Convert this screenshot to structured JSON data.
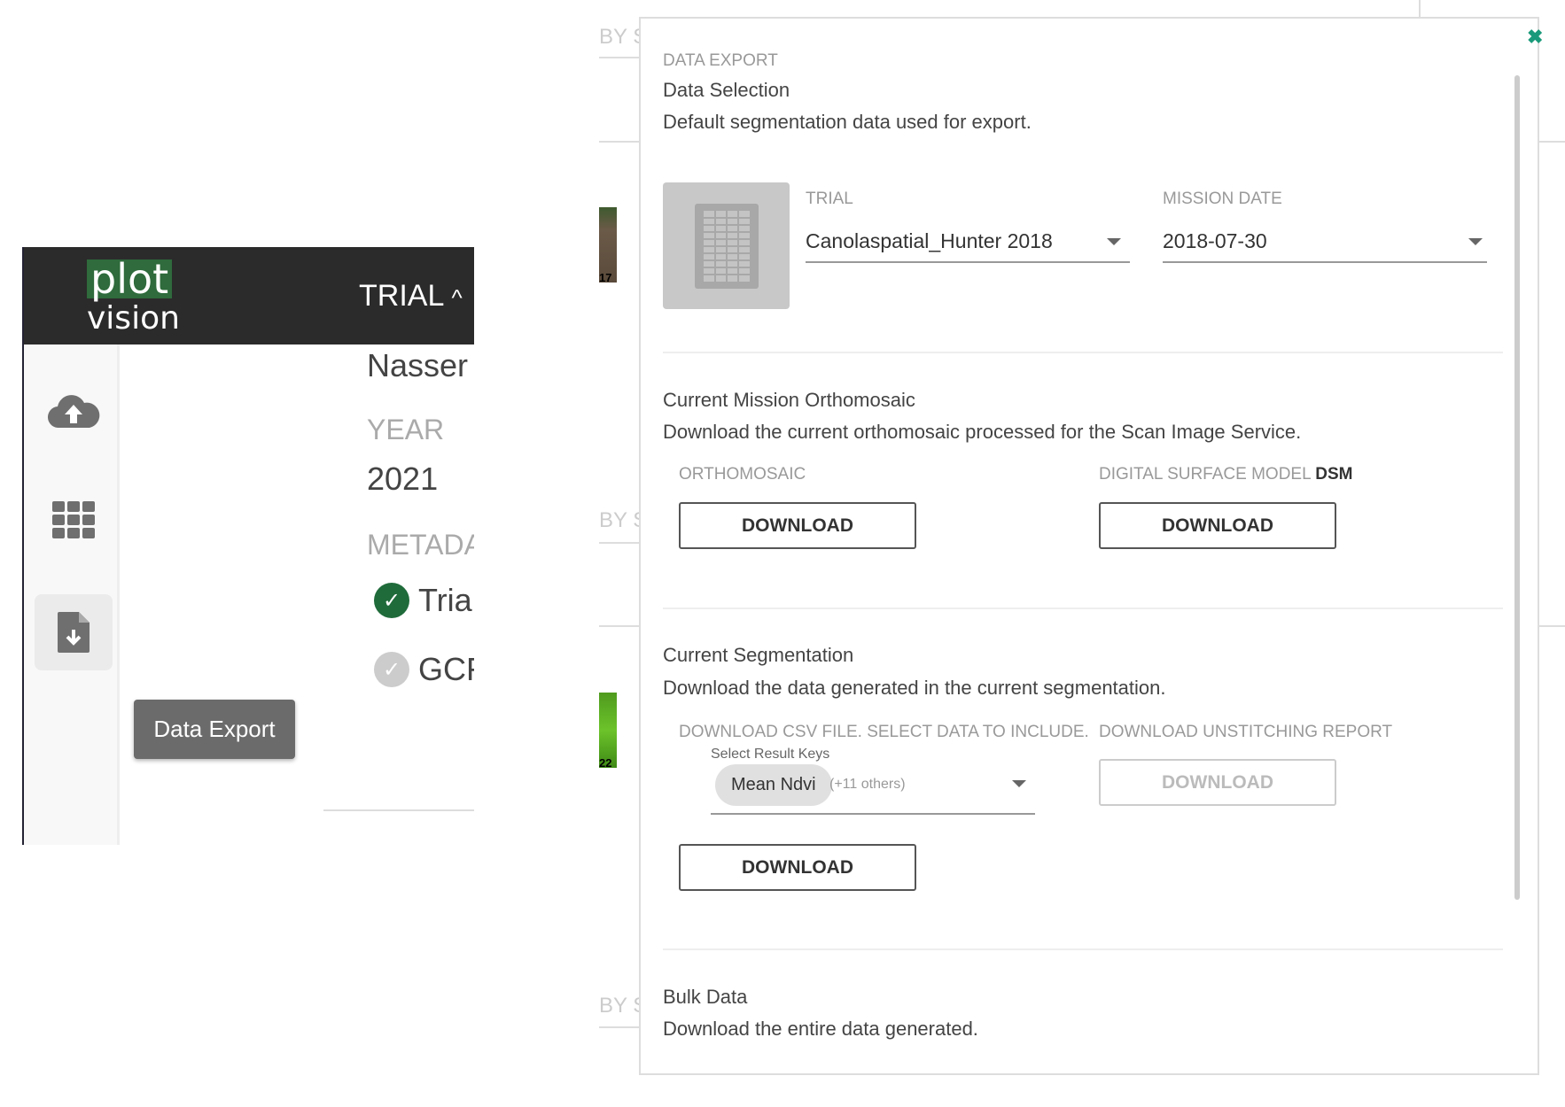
{
  "app": {
    "logo_top": "plot",
    "logo_bottom": "vision",
    "header_title": "TRIAL",
    "sidebar": [
      {
        "icon": "cloud-upload-icon"
      },
      {
        "icon": "grid-icon"
      },
      {
        "icon": "file-download-icon",
        "tooltip": "Data Export"
      }
    ],
    "panel": {
      "name": "Nasser",
      "year_label": "YEAR",
      "year": "2021",
      "metadata_label": "METADA",
      "metadata_items": [
        {
          "label": "Trial",
          "status": "complete",
          "color": "#1f6b3a"
        },
        {
          "label": "GCF",
          "status": "pending",
          "color": "#cccccc"
        }
      ]
    },
    "background_labels": [
      "BY ST",
      "BY ST",
      "BY ST"
    ],
    "background_thumb_labels": [
      "17",
      "22"
    ]
  },
  "dialog": {
    "caption": "DATA EXPORT",
    "close_icon": "close-icon",
    "accent": "#1a9a7a",
    "selection": {
      "title": "Data Selection",
      "description": "Default segmentation data used for export.",
      "trial_label": "TRIAL",
      "trial_value": "Canolaspatial_Hunter 2018",
      "date_label": "MISSION DATE",
      "date_value": "2018-07-30"
    },
    "orthomosaic": {
      "title": "Current Mission Orthomosaic",
      "description": "Download the current orthomosaic processed for the Scan Image Service.",
      "ortho_label": "ORTHOMOSAIC",
      "dsm_label": "DIGITAL SURFACE MODEL",
      "dsm_bold": "DSM",
      "ortho_button": "DOWNLOAD",
      "dsm_button": "DOWNLOAD"
    },
    "segmentation": {
      "title": "Current Segmentation",
      "description": "Download the data generated in the current segmentation.",
      "csv_label": "DOWNLOAD CSV FILE. SELECT DATA TO INCLUDE.",
      "select_label": "Select Result Keys",
      "chip": "Mean Ndvi",
      "others": "(+11 others)",
      "csv_button": "DOWNLOAD",
      "unstitch_label": "DOWNLOAD UNSTITCHING REPORT",
      "unstitch_button": "DOWNLOAD"
    },
    "bulk": {
      "title": "Bulk Data",
      "description": "Download the entire data generated."
    }
  }
}
